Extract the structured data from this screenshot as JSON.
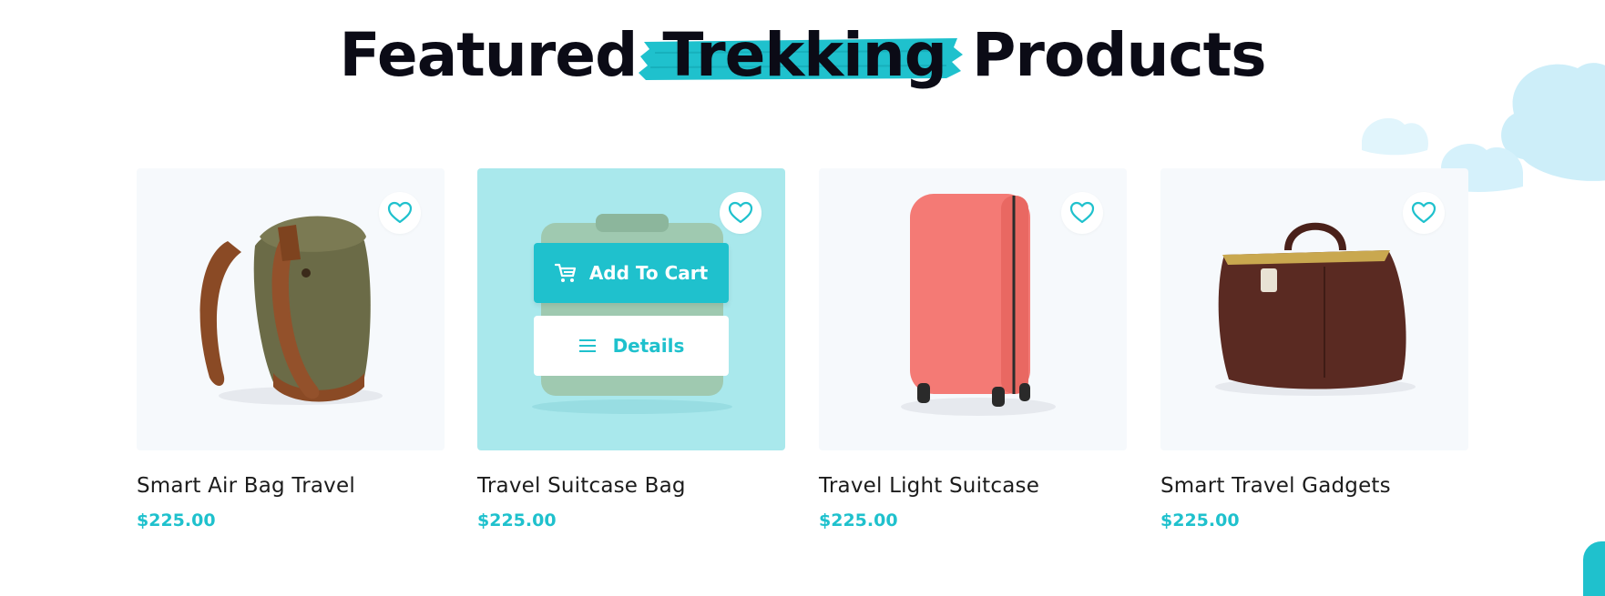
{
  "section": {
    "heading_before": "Featured",
    "heading_highlight": "Trekking",
    "heading_after": "Products"
  },
  "colors": {
    "accent": "#1fc1cd",
    "active_card_bg": "#a9e8ec",
    "card_bg": "#f6f9fc",
    "heading": "#0b0b16"
  },
  "products": [
    {
      "title": "Smart Air Bag Travel",
      "price": "$225.00",
      "image": "backpack"
    },
    {
      "title": "Travel Suitcase Bag",
      "price": "$225.00",
      "image": "suitcase-green"
    },
    {
      "title": "Travel Light Suitcase",
      "price": "$225.00",
      "image": "suitcase-pink"
    },
    {
      "title": "Smart Travel Gadgets",
      "price": "$225.00",
      "image": "leather-bag"
    }
  ],
  "actions": {
    "add_to_cart": "Add To Cart",
    "details": "Details"
  },
  "icons": {
    "favorite": "heart-icon",
    "cart": "cart-icon",
    "details": "menu-lines-icon"
  }
}
